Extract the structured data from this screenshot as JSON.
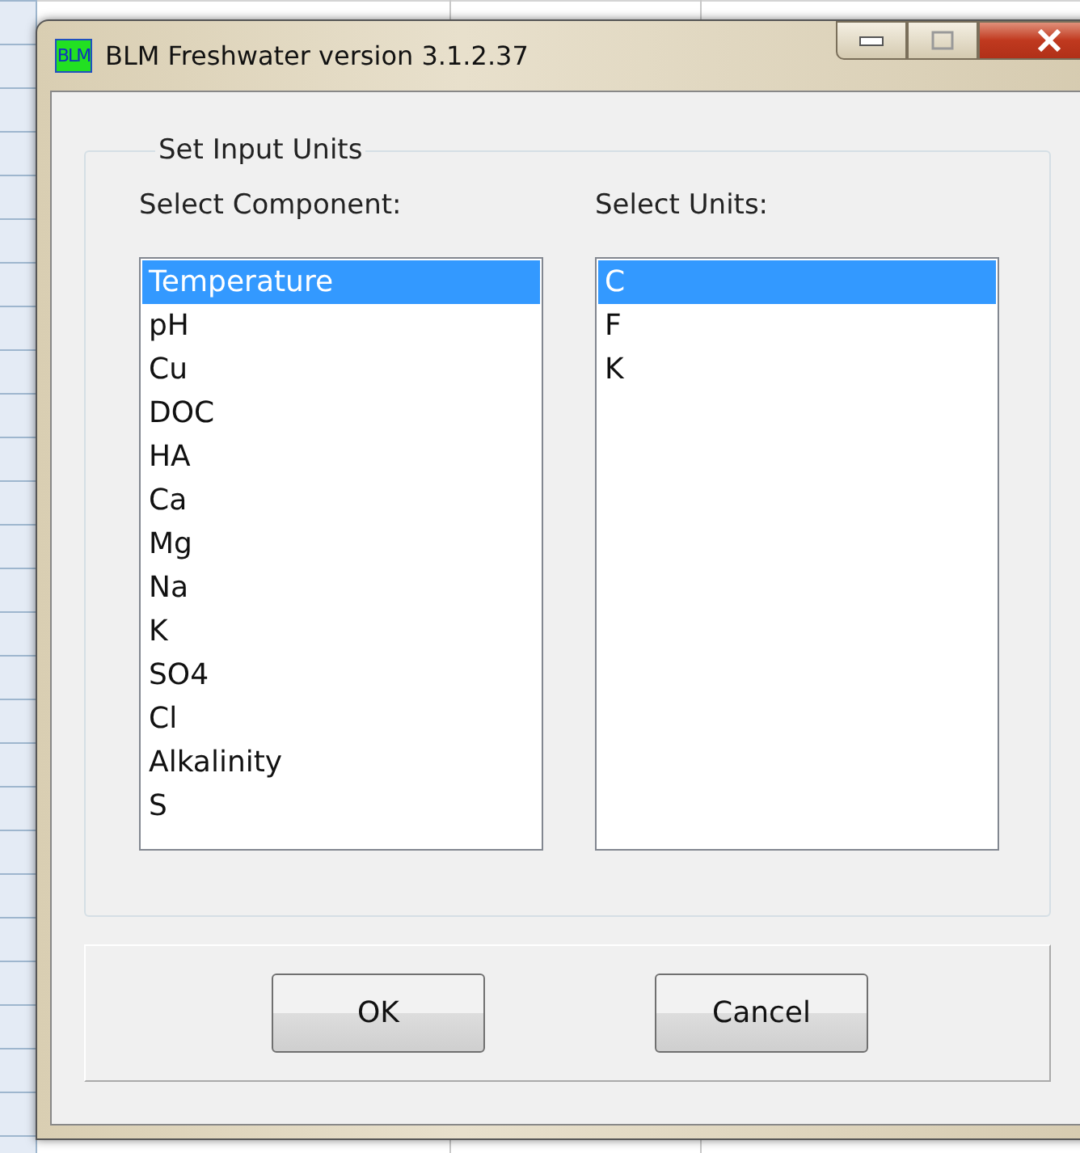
{
  "window": {
    "title": "BLM Freshwater version 3.1.2.37",
    "logo": "BLM"
  },
  "group": {
    "title": "Set Input Units"
  },
  "components": {
    "label": "Select Component:",
    "items": [
      {
        "label": "Temperature",
        "selected": true
      },
      {
        "label": "pH",
        "selected": false
      },
      {
        "label": "Cu",
        "selected": false
      },
      {
        "label": "DOC",
        "selected": false
      },
      {
        "label": "HA",
        "selected": false
      },
      {
        "label": "Ca",
        "selected": false
      },
      {
        "label": "Mg",
        "selected": false
      },
      {
        "label": "Na",
        "selected": false
      },
      {
        "label": "K",
        "selected": false
      },
      {
        "label": "SO4",
        "selected": false
      },
      {
        "label": "Cl",
        "selected": false
      },
      {
        "label": "Alkalinity",
        "selected": false
      },
      {
        "label": "S",
        "selected": false
      }
    ]
  },
  "units": {
    "label": "Select Units:",
    "items": [
      {
        "label": "C",
        "selected": true
      },
      {
        "label": "F",
        "selected": false
      },
      {
        "label": "K",
        "selected": false
      }
    ]
  },
  "buttons": [
    "OK",
    "Cancel"
  ]
}
